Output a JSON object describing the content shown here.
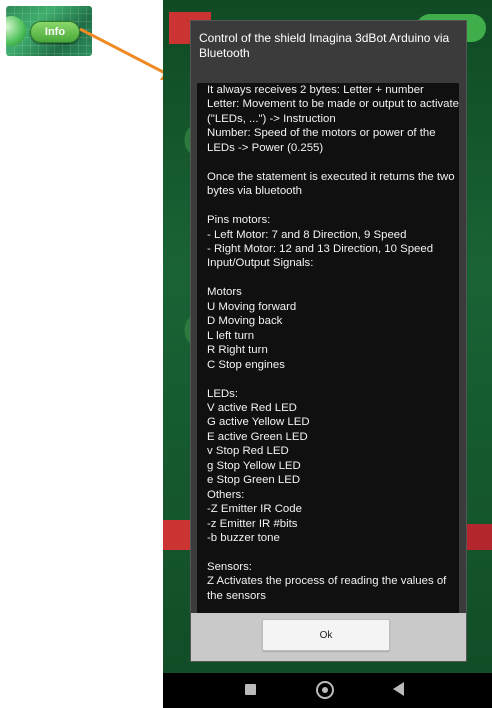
{
  "thumbnail": {
    "button_label": "Info"
  },
  "dialog": {
    "title": "Control of the shield Imagina 3dBot Arduino via Bluetooth",
    "body": "It always receives 2 bytes: Letter + number\nLetter: Movement to be made or output to activate (\"LEDs, ...\") -> Instruction\nNumber: Speed of the motors or power of the LEDs -> Power (0.255)\n\nOnce the statement is executed it returns the two bytes via bluetooth\n\nPins motors:\n- Left Motor: 7 and 8 Direction, 9 Speed\n- Right Motor: 12 and 13 Direction, 10 Speed\nInput/Output Signals:\n\nMotors\nU Moving forward\nD Moving back\nL left turn\nR Right turn\nC Stop engines\n\nLEDs:\nV active Red LED\nG active Yellow LED\nE active Green LED\nv Stop Red LED\ng Stop Yellow LED\ne Stop Green LED\nOthers:\n-Z Emitter IR Code\n-z Emitter IR #bits\n-b buzzer tone\n\nSensors:\nZ Activates the process of reading the values of the sensors",
    "ok_label": "Ok"
  },
  "nav": {
    "icons": [
      "recents-icon",
      "home-icon",
      "back-icon"
    ]
  },
  "colors": {
    "arrow": "#f08a24",
    "dialog_bg": "#3b3b3b",
    "body_bg": "#101010",
    "footer_bg": "#c9c9c9"
  }
}
